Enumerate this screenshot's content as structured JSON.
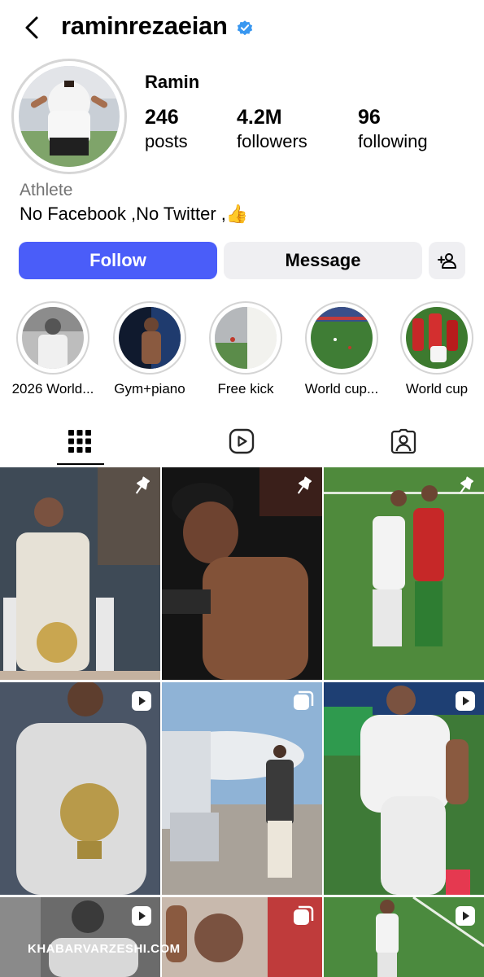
{
  "header": {
    "username": "raminrezaeian",
    "back_icon": "chevron-left-icon",
    "verified_icon": "verified-badge-icon",
    "verified_color": "#3897f0"
  },
  "profile": {
    "display_name": "Ramin",
    "stats": [
      {
        "value": "246",
        "label": "posts"
      },
      {
        "value": "4.2M",
        "label": "followers"
      },
      {
        "value": "96",
        "label": "following"
      }
    ],
    "category": "Athlete",
    "bio": "No Facebook ,No Twitter ,👍"
  },
  "actions": {
    "follow_label": "Follow",
    "message_label": "Message",
    "add_person_icon": "add-person-icon",
    "follow_color": "#4a5df9"
  },
  "highlights": [
    {
      "label": "2026 World..."
    },
    {
      "label": "Gym+piano"
    },
    {
      "label": "Free kick"
    },
    {
      "label": "World cup..."
    },
    {
      "label": "World cup"
    }
  ],
  "tabs": [
    {
      "icon": "grid-icon",
      "active": true
    },
    {
      "icon": "reels-icon",
      "active": false
    },
    {
      "icon": "tagged-icon",
      "active": false
    }
  ],
  "posts": [
    {
      "badge": "pin-icon"
    },
    {
      "badge": "pin-icon"
    },
    {
      "badge": "pin-icon"
    },
    {
      "badge": "reel-icon"
    },
    {
      "badge": "carousel-icon"
    },
    {
      "badge": "reel-icon"
    },
    {
      "badge": "reel-icon"
    },
    {
      "badge": "carousel-icon"
    },
    {
      "badge": "reel-icon"
    }
  ],
  "watermark": "KHABARVARZESHI.COM"
}
